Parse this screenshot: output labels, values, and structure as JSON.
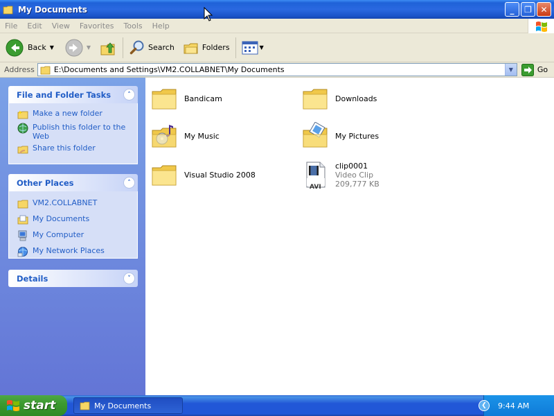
{
  "window": {
    "title": "My Documents"
  },
  "menu": [
    "File",
    "Edit",
    "View",
    "Favorites",
    "Tools",
    "Help"
  ],
  "toolbar": {
    "back": "Back",
    "search": "Search",
    "folders": "Folders"
  },
  "address": {
    "label": "Address",
    "value": "E:\\Documents and Settings\\VM2.COLLABNET\\My Documents",
    "go": "Go"
  },
  "tasks_panel": {
    "title": "File and Folder Tasks",
    "items": [
      "Make a new folder",
      "Publish this folder to the Web",
      "Share this folder"
    ]
  },
  "places_panel": {
    "title": "Other Places",
    "items": [
      "VM2.COLLABNET",
      "My Documents",
      "My Computer",
      "My Network Places"
    ]
  },
  "details_panel": {
    "title": "Details"
  },
  "files": [
    {
      "name": "Bandicam"
    },
    {
      "name": "Downloads"
    },
    {
      "name": "My Music"
    },
    {
      "name": "My Pictures"
    },
    {
      "name": "Visual Studio 2008"
    },
    {
      "name": "clip0001",
      "type": "Video Clip",
      "size": "209,777 KB",
      "badge": "AVI"
    }
  ],
  "taskbar": {
    "start": "start",
    "task": "My Documents",
    "clock": "9:44 AM"
  },
  "colors": {
    "title_blue": "#1f62d8",
    "link_blue": "#215dc6",
    "start_green": "#3c9a2f",
    "folder_yellow": "#f6d665"
  }
}
